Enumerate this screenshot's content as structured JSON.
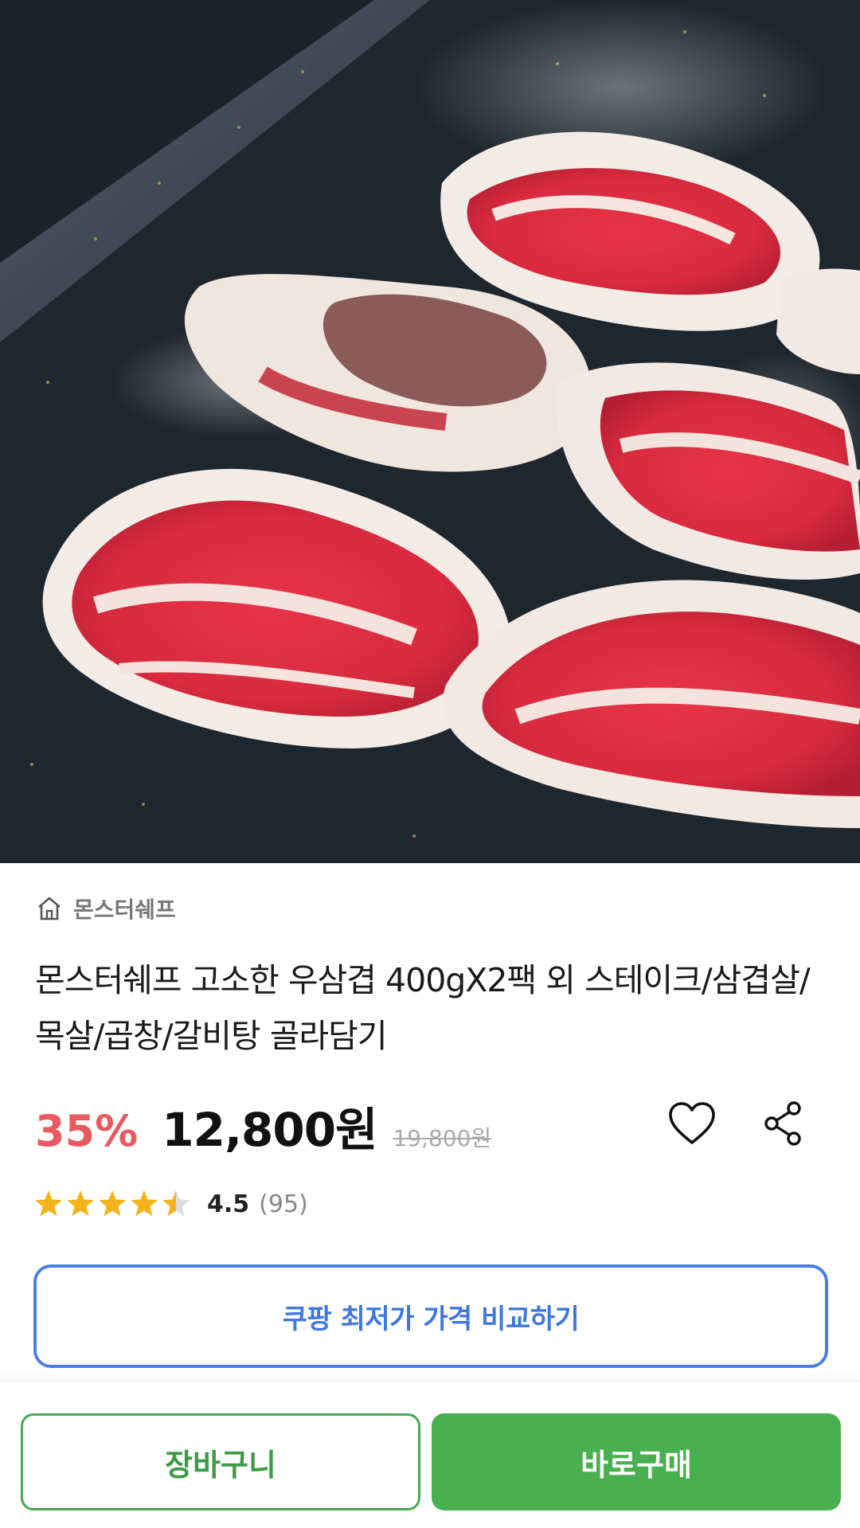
{
  "product": {
    "image_alt": "beef brisket slices on grill",
    "store_icon": "home-icon",
    "store_name": "몬스터쉐프",
    "title": "몬스터쉐프 고소한 우삼겹 400gX2팩 외 스테이크/삼겹살/목살/곱창/갈비탕 골라담기",
    "discount": "35%",
    "price": "12,800원",
    "original_price": "19,800원",
    "wishlist_icon": "heart-icon",
    "share_icon": "share-icon",
    "rating": {
      "value": 4.5,
      "score_text": "4.5",
      "count_text": "(95)",
      "max_stars": 5
    }
  },
  "compare_button": "쿠팡 최저가 가격 비교하기",
  "bottom_bar": {
    "cart_label": "장바구니",
    "buy_label": "바로구매"
  },
  "colors": {
    "discount": "#e85a5f",
    "compare_border": "#4a7fe0",
    "primary_green": "#48b04f",
    "star": "#f5b31b"
  }
}
